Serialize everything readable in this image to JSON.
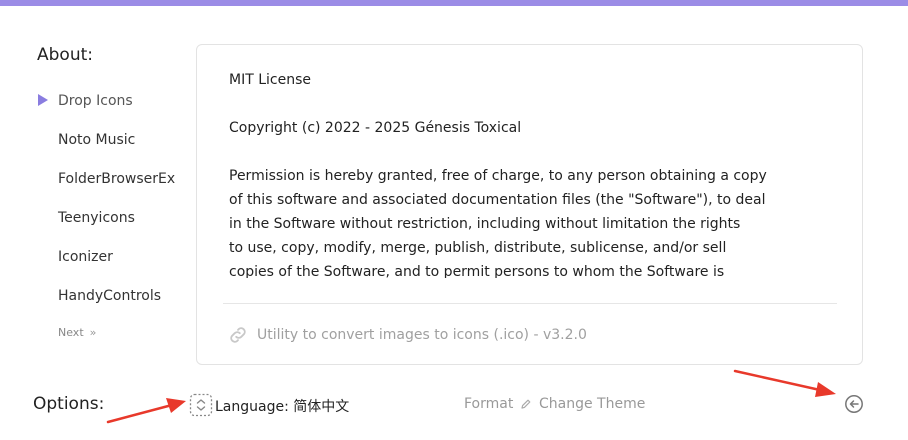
{
  "colors": {
    "accent": "#9b8ce6",
    "arrow": "#e8392b"
  },
  "about": {
    "title": "About:",
    "items": [
      {
        "label": "Drop Icons",
        "active": true
      },
      {
        "label": "Noto Music"
      },
      {
        "label": "FolderBrowserEx"
      },
      {
        "label": "Teenyicons"
      },
      {
        "label": "Iconizer"
      },
      {
        "label": "HandyControls"
      }
    ],
    "next_label": "Next",
    "next_icon": "double-chevron-right-icon"
  },
  "license": {
    "title": "MIT License",
    "copyright": "Copyright (c) 2022 - 2025 Génesis Toxical",
    "lines": [
      "Permission is hereby granted, free of charge, to any person obtaining a copy",
      "of this software and associated documentation files (the \"Software\"), to deal",
      "in the Software without restriction, including without limitation the rights",
      "to use, copy, modify, merge, publish, distribute, sublicense, and/or sell",
      "copies of the Software, and to permit persons to whom the Software is"
    ],
    "footer": "Utility to convert images to icons (.ico) - v3.2.0",
    "footer_icon": "link-icon"
  },
  "options": {
    "title": "Options:",
    "language_label": "Language: 简体中文",
    "language_icon": "language-selector-icon",
    "format_label": "Format",
    "theme_label": "Change Theme",
    "theme_icon": "pencil-icon",
    "back_icon": "back-arrow-icon"
  }
}
